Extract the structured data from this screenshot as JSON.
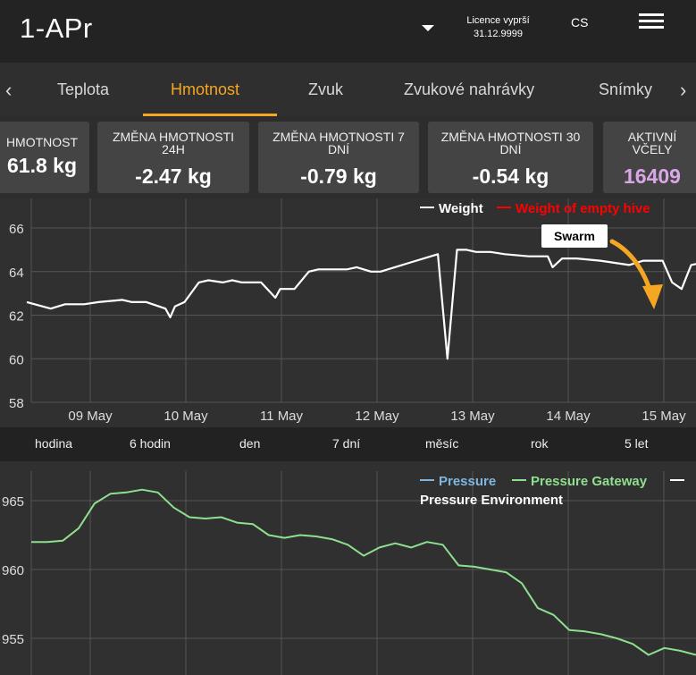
{
  "header": {
    "title": "1-APr",
    "licence_label": "Licence vyprší",
    "licence_date": "31.12.9999",
    "language": "CS"
  },
  "tabs": [
    {
      "label": "Teplota",
      "active": false
    },
    {
      "label": "Hmotnost",
      "active": true
    },
    {
      "label": "Zvuk",
      "active": false
    },
    {
      "label": "Zvukové nahrávky",
      "active": false
    },
    {
      "label": "Snímky",
      "active": false
    }
  ],
  "cards": [
    {
      "label": "HMOTNOST",
      "value": "61.8 kg"
    },
    {
      "label": "ZMĚNA HMOTNOSTI 24H",
      "value": "-2.47 kg"
    },
    {
      "label": "ZMĚNA HMOTNOSTI 7 DNÍ",
      "value": "-0.79 kg"
    },
    {
      "label": "ZMĚNA HMOTNOSTI 30 DNÍ",
      "value": "-0.54 kg"
    },
    {
      "label": "AKTIVNÍ VČELY",
      "value": "16409"
    }
  ],
  "range_buttons": [
    "hodina",
    "6 hodin",
    "den",
    "7 dní",
    "měsíc",
    "rok",
    "5 let"
  ],
  "colors": {
    "accent": "#f5a623",
    "weight": "#ffffff",
    "empty_hive": "#ff0000",
    "pressure": "#7fb6e0",
    "pressure_gateway": "#8ee08e",
    "bees": "#d9a7e8"
  },
  "chart_data": [
    {
      "type": "line",
      "ylim": [
        58,
        67
      ],
      "yticks": [
        58,
        60,
        62,
        64,
        66
      ],
      "xticks": [
        "09 May",
        "10 May",
        "11 May",
        "12 May",
        "13 May",
        "14 May",
        "15 May"
      ],
      "legend": [
        "Weight",
        "Weight of empty hive"
      ],
      "legend_position": "top-right",
      "annotation": "Swarm",
      "series": [
        {
          "name": "Weight",
          "x": [
            0,
            0.5,
            0.8,
            1.2,
            1.5,
            2.0,
            2.2,
            2.5,
            2.9,
            3.0,
            3.1,
            3.3,
            3.6,
            3.8,
            4.1,
            4.3,
            4.5,
            4.9,
            5.2,
            5.3,
            5.6,
            5.9,
            6.1,
            6.3,
            6.7,
            6.9,
            7.2,
            7.4,
            7.7,
            8.0,
            8.6,
            8.8,
            9.0,
            9.2,
            9.4,
            9.7,
            10.0,
            10.5,
            10.9,
            11.0,
            11.2,
            11.5,
            12.0,
            12.6,
            12.9,
            13.3,
            13.5,
            13.7,
            13.9,
            14.3,
            14.6
          ],
          "values": [
            62.6,
            62.3,
            62.5,
            62.5,
            62.6,
            62.7,
            62.6,
            62.6,
            62.3,
            61.9,
            62.4,
            62.6,
            63.5,
            63.6,
            63.5,
            63.6,
            63.5,
            63.5,
            62.8,
            63.2,
            63.2,
            64.0,
            64.1,
            64.1,
            64.1,
            64.2,
            64.0,
            64.0,
            64.2,
            64.4,
            64.8,
            60.0,
            65.0,
            65.0,
            64.9,
            64.9,
            64.8,
            64.7,
            64.7,
            64.2,
            64.6,
            64.6,
            64.5,
            64.3,
            64.5,
            64.5,
            63.5,
            63.2,
            64.3,
            64.5,
            64.5
          ]
        },
        {
          "name": "Weight of empty hive",
          "values": []
        }
      ]
    },
    {
      "type": "line",
      "yticks": [
        955,
        960,
        965
      ],
      "ylim": [
        952.5,
        967
      ],
      "legend": [
        "Pressure",
        "Pressure Gateway",
        "Pressure Environment"
      ],
      "legend_position": "top-right",
      "series": [
        {
          "name": "Pressure Gateway",
          "values": [
            962.0,
            962.0,
            962.1,
            963.0,
            964.8,
            965.5,
            965.6,
            965.8,
            965.6,
            964.5,
            963.8,
            963.7,
            963.8,
            963.4,
            963.3,
            962.5,
            962.3,
            962.5,
            962.4,
            962.2,
            961.8,
            961.0,
            961.6,
            961.9,
            961.6,
            962.0,
            961.8,
            960.3,
            960.2,
            960.0,
            959.8,
            959.0,
            957.2,
            956.7,
            955.6,
            955.5,
            955.3,
            955.0,
            954.6,
            953.8,
            954.3,
            954.1,
            953.8
          ]
        },
        {
          "name": "Pressure",
          "values": []
        },
        {
          "name": "Pressure Environment",
          "values": []
        }
      ]
    }
  ]
}
